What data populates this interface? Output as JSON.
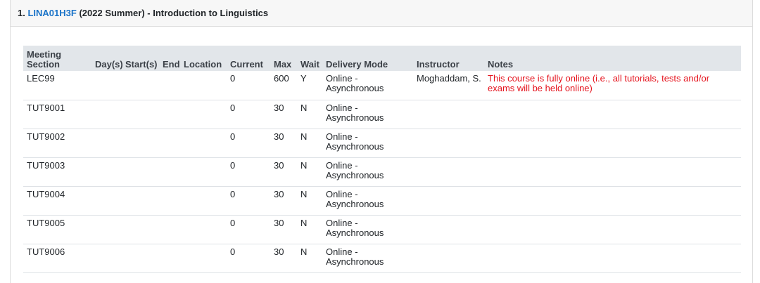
{
  "course": {
    "number": "1.",
    "code": "LINA01H3F",
    "rest_of_title": "(2022 Summer) - Introduction to Linguistics"
  },
  "table": {
    "headers": {
      "meeting_section": "Meeting Section",
      "days": "Day(s)",
      "start": "Start(s)",
      "end": "End",
      "location": "Location",
      "current": "Current",
      "max": "Max",
      "wait": "Wait",
      "delivery_mode": "Delivery Mode",
      "instructor": "Instructor",
      "notes": "Notes"
    },
    "rows": [
      {
        "section": "LEC99",
        "days": "",
        "start": "",
        "end": "",
        "location": "",
        "current": "0",
        "max": "600",
        "wait": "Y",
        "delivery": "Online - Asynchronous",
        "instructor": "Moghaddam, S.",
        "notes": "This course is fully online (i.e., all tutorials, tests and/or exams will be held online)"
      },
      {
        "section": "TUT9001",
        "days": "",
        "start": "",
        "end": "",
        "location": "",
        "current": "0",
        "max": "30",
        "wait": "N",
        "delivery": "Online - Asynchronous",
        "instructor": "",
        "notes": ""
      },
      {
        "section": "TUT9002",
        "days": "",
        "start": "",
        "end": "",
        "location": "",
        "current": "0",
        "max": "30",
        "wait": "N",
        "delivery": "Online - Asynchronous",
        "instructor": "",
        "notes": ""
      },
      {
        "section": "TUT9003",
        "days": "",
        "start": "",
        "end": "",
        "location": "",
        "current": "0",
        "max": "30",
        "wait": "N",
        "delivery": "Online - Asynchronous",
        "instructor": "",
        "notes": ""
      },
      {
        "section": "TUT9004",
        "days": "",
        "start": "",
        "end": "",
        "location": "",
        "current": "0",
        "max": "30",
        "wait": "N",
        "delivery": "Online - Asynchronous",
        "instructor": "",
        "notes": ""
      },
      {
        "section": "TUT9005",
        "days": "",
        "start": "",
        "end": "",
        "location": "",
        "current": "0",
        "max": "30",
        "wait": "N",
        "delivery": "Online - Asynchronous",
        "instructor": "",
        "notes": ""
      },
      {
        "section": "TUT9006",
        "days": "",
        "start": "",
        "end": "",
        "location": "",
        "current": "0",
        "max": "30",
        "wait": "N",
        "delivery": "Online - Asynchronous",
        "instructor": "",
        "notes": ""
      }
    ]
  },
  "colors": {
    "link": "#1a73c8",
    "notes_text": "#e5131d",
    "header_bg": "#e2e6ea",
    "panel_heading_bg": "#f7f7f7"
  }
}
